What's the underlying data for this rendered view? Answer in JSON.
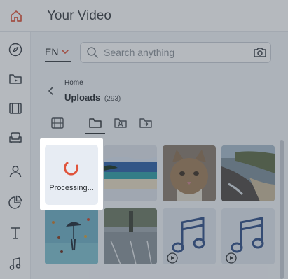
{
  "app": {
    "title": "Your Video",
    "accent": "#e0543b"
  },
  "toolbar": {
    "language": "EN",
    "search": {
      "placeholder": "Search anything"
    }
  },
  "sidebar": {
    "items": [
      {
        "name": "explore",
        "icon": "compass-icon"
      },
      {
        "name": "media",
        "icon": "folder-media-icon"
      },
      {
        "name": "video",
        "icon": "film-icon"
      },
      {
        "name": "furniture",
        "icon": "armchair-icon"
      },
      {
        "name": "person",
        "icon": "person-icon"
      },
      {
        "name": "chart",
        "icon": "pie-chart-icon"
      },
      {
        "name": "text",
        "icon": "text-icon"
      },
      {
        "name": "audio",
        "icon": "music-note-icon"
      }
    ]
  },
  "breadcrumb": {
    "home": "Home",
    "title": "Uploads",
    "count": "(293)"
  },
  "tabs": [
    {
      "icon": "film-strip-icon",
      "active": false
    },
    {
      "icon": "folder-icon",
      "active": true
    },
    {
      "icon": "folder-person-icon",
      "active": false
    },
    {
      "icon": "folder-export-icon",
      "active": false
    }
  ],
  "grid": {
    "processing_label": "Processing...",
    "items": [
      {
        "type": "processing"
      },
      {
        "type": "image",
        "subject": "tropical beach"
      },
      {
        "type": "image",
        "subject": "tabby cat"
      },
      {
        "type": "image",
        "subject": "rocky coastline"
      },
      {
        "type": "image",
        "subject": "umbrella illustration"
      },
      {
        "type": "image",
        "subject": "parking lot"
      },
      {
        "type": "audio",
        "icon": "music-note-icon"
      },
      {
        "type": "audio",
        "icon": "music-note-icon"
      }
    ]
  }
}
